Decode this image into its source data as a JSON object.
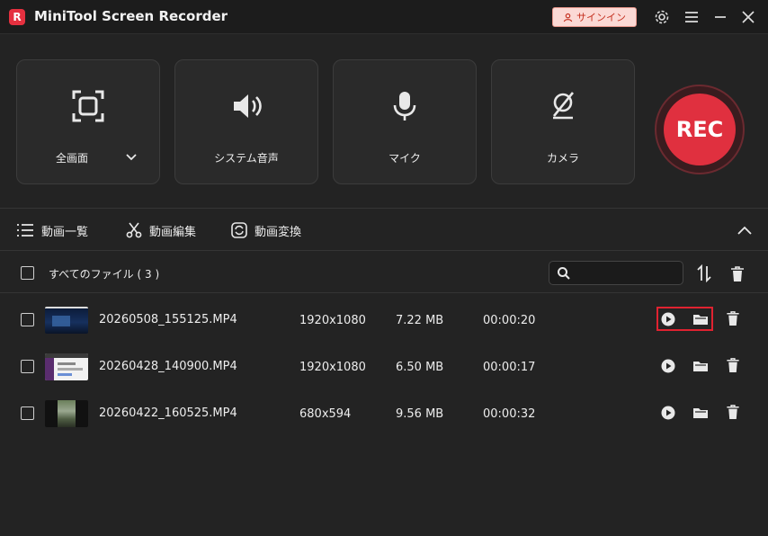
{
  "app": {
    "logo_letter": "R",
    "title": "MiniTool Screen Recorder",
    "signin_label": "サインイン"
  },
  "titlebar": {
    "icons": [
      "settings-icon",
      "menu-icon",
      "minimize-icon",
      "close-icon"
    ]
  },
  "controls": {
    "cards": [
      {
        "label": "全画面",
        "icon": "fullscreen-icon",
        "has_dropdown": true
      },
      {
        "label": "システム音声",
        "icon": "speaker-icon"
      },
      {
        "label": "マイク",
        "icon": "microphone-icon"
      },
      {
        "label": "カメラ",
        "icon": "camera-off-icon"
      }
    ],
    "rec_label": "REC",
    "rec_color": "#e0303f"
  },
  "tabs": [
    {
      "label": "動画一覧",
      "icon": "list-icon"
    },
    {
      "label": "動画編集",
      "icon": "scissors-icon"
    },
    {
      "label": "動画変換",
      "icon": "convert-icon"
    }
  ],
  "list": {
    "all_files_label": "すべてのファイル ( 3 )",
    "search": {
      "value": "",
      "placeholder": ""
    },
    "rows": [
      {
        "name": "20260508_155125.MP4",
        "resolution": "1920x1080",
        "size": "7.22 MB",
        "duration": "00:00:20",
        "thumb": "dark-blue-screen"
      },
      {
        "name": "20260428_140900.MP4",
        "resolution": "1920x1080",
        "size": "6.50 MB",
        "duration": "00:00:17",
        "thumb": "browser-page"
      },
      {
        "name": "20260422_160525.MP4",
        "resolution": "680x594",
        "size": "9.56 MB",
        "duration": "00:00:32",
        "thumb": "portrait-photo"
      }
    ]
  },
  "colors": {
    "accent_red": "#e0303f",
    "background": "#232323",
    "highlight_box": "#e02230"
  }
}
